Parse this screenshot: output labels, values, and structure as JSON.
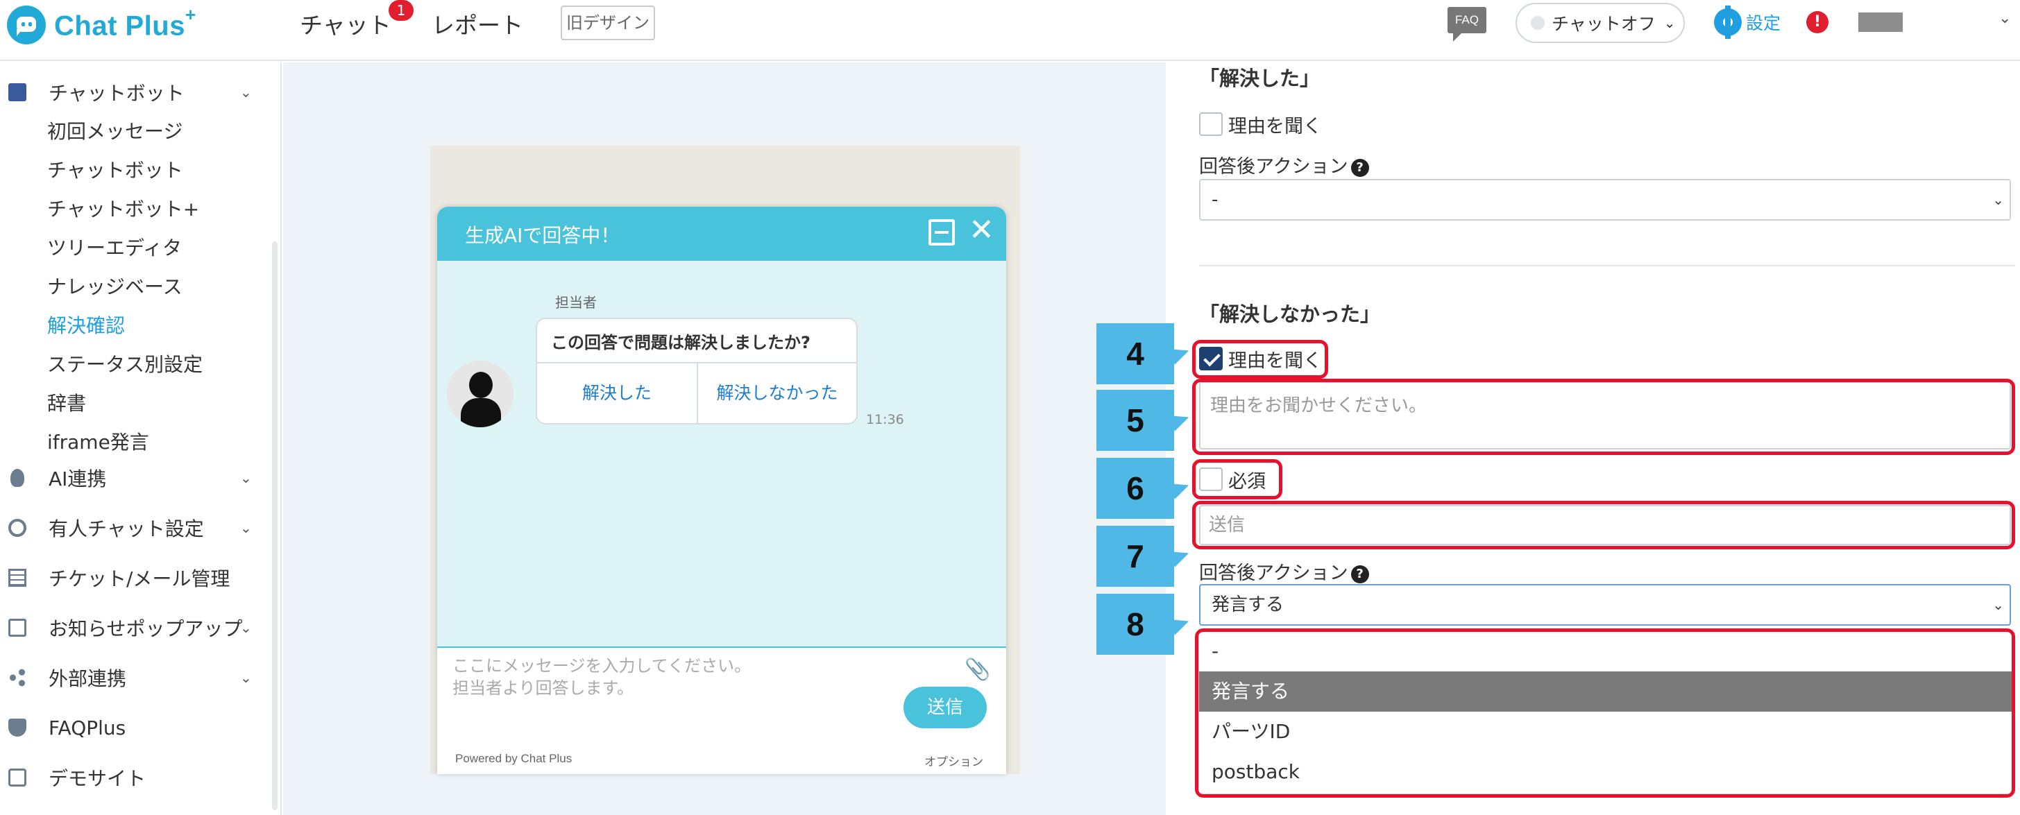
{
  "header": {
    "logo_text": "Chat Plus",
    "logo_plus": "+",
    "nav_chat": "チャット",
    "nav_chat_badge": "1",
    "nav_report": "レポート",
    "old_design": "旧デザイン",
    "faq_icon_label": "FAQ",
    "chat_status": "チャットオフ",
    "settings_label": "設定",
    "alert_mark": "!"
  },
  "sidebar": {
    "chatbot_group": "チャットボット",
    "chatbot_items": [
      "初回メッセージ",
      "チャットボット",
      "チャットボット+",
      "ツリーエディタ",
      "ナレッジベース",
      "解決確認",
      "ステータス別設定",
      "辞書",
      "iframe発言"
    ],
    "active_item": "解決確認",
    "groups": [
      "AI連携",
      "有人チャット設定",
      "チケット/メール管理",
      "お知らせポップアップ",
      "外部連携",
      "FAQPlus",
      "デモサイト"
    ]
  },
  "widget": {
    "title": "生成AIで回答中！",
    "agent_name": "担当者",
    "question": "この回答で問題は解決しましたか?",
    "btn_resolved": "解決した",
    "btn_unresolved": "解決しなかった",
    "time": "11:36",
    "input_placeholder_line1": "ここにメッセージを入力してください。",
    "input_placeholder_line2": "担当者より回答します。",
    "send": "送信",
    "powered": "Powered by Chat Plus",
    "option": "オプション"
  },
  "form": {
    "resolved_title": "「解決した」",
    "resolved_ask_reason": "理由を聞く",
    "resolved_ask_reason_checked": false,
    "after_action_label": "回答後アクション",
    "resolved_action_value": "-",
    "unresolved_title": "「解決しなかった」",
    "unresolved_ask_reason": "理由を聞く",
    "unresolved_ask_reason_checked": true,
    "reason_placeholder": "理由をお聞かせください。",
    "required_label": "必須",
    "required_checked": false,
    "send_placeholder": "送信",
    "unresolved_action_value": "発言する",
    "action_options": [
      "-",
      "発言する",
      "パーツID",
      "postback"
    ],
    "action_selected": "発言する"
  },
  "callouts": [
    "4",
    "5",
    "6",
    "7",
    "8"
  ],
  "colors": {
    "brand": "#21a9d8",
    "widget_header": "#49c2dc",
    "callout": "#4fb8e6",
    "highlight": "#e8112d",
    "checked": "#1d3f72"
  }
}
